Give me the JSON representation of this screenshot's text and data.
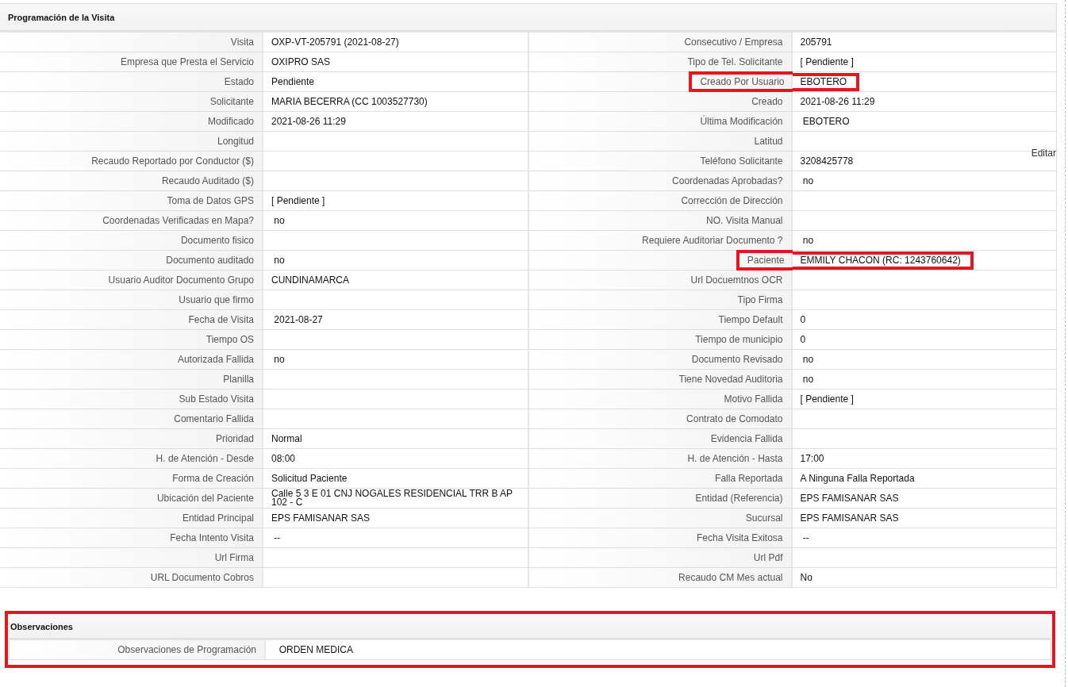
{
  "sections": [
    {
      "title": "Programación de la Visita",
      "highlighted": false,
      "rows": [
        {
          "cells": [
            {
              "label": "Visita",
              "value": "OXP-VT-205791 (2021-08-27)",
              "highlighted": false
            },
            {
              "label": "Consecutivo / Empresa",
              "value": "205791",
              "highlighted": false
            }
          ]
        },
        {
          "cells": [
            {
              "label": "Empresa que Presta el Servicio",
              "value": "OXIPRO SAS",
              "highlighted": false
            },
            {
              "label": "Tipo de Tel. Solicitante",
              "value": "[ Pendiente ]",
              "highlighted": false
            }
          ]
        },
        {
          "cells": [
            {
              "label": "Estado",
              "value": "Pendiente",
              "highlighted": false
            },
            {
              "label": "Creado Por Usuario",
              "value": "EBOTERO",
              "highlighted": true
            }
          ]
        },
        {
          "cells": [
            {
              "label": "Solicitante",
              "value": "MARIA BECERRA (CC 1003527730)",
              "highlighted": false
            },
            {
              "label": "Creado",
              "value": "2021-08-26 11:29",
              "highlighted": false
            }
          ]
        },
        {
          "cells": [
            {
              "label": "Modificado",
              "value": "2021-08-26 11:29",
              "highlighted": false
            },
            {
              "label": "Última Modificación",
              "value": " EBOTERO",
              "highlighted": false
            }
          ]
        },
        {
          "cells": [
            {
              "label": "Longitud",
              "highlighted": false
            },
            {
              "label": "Latitud",
              "highlighted": false
            }
          ]
        },
        {
          "cells": [
            {
              "label": "Recaudo Reportado por Conductor ($)",
              "highlighted": false
            },
            {
              "label": "Teléfono Solicitante",
              "value": "3208425778",
              "highlighted": false,
              "edit_link": "Editar"
            }
          ]
        },
        {
          "cells": [
            {
              "label": "Recaudo Auditado ($)",
              "highlighted": false
            },
            {
              "label": "Coordenadas Aprobadas?",
              "value": " no",
              "highlighted": false
            }
          ]
        },
        {
          "cells": [
            {
              "label": "Toma de Datos GPS",
              "value": "[ Pendiente ]",
              "highlighted": false
            },
            {
              "label": "Corrección de Dirección",
              "highlighted": false
            }
          ]
        },
        {
          "cells": [
            {
              "label": "Coordenadas Verificadas en Mapa?",
              "value": " no",
              "highlighted": false
            },
            {
              "label": "NO. Visita Manual",
              "highlighted": false
            }
          ]
        },
        {
          "cells": [
            {
              "label": "Documento fisico",
              "highlighted": false
            },
            {
              "label": "Requiere Auditoriar Documento ?",
              "value": " no",
              "highlighted": false
            }
          ]
        },
        {
          "cells": [
            {
              "label": "Documento auditado",
              "value": " no",
              "highlighted": false
            },
            {
              "label": "Paciente",
              "value": "EMMILY CHACON (RC: 1243760642)",
              "highlighted": true
            }
          ]
        },
        {
          "cells": [
            {
              "label": "Usuario Auditor Documento Grupo",
              "value": "CUNDINAMARCA",
              "highlighted": false
            },
            {
              "label": "Url Docuemtnos OCR",
              "highlighted": false
            }
          ]
        },
        {
          "cells": [
            {
              "label": "Usuario que firmo",
              "highlighted": false
            },
            {
              "label": "Tipo Firma",
              "highlighted": false
            }
          ]
        },
        {
          "cells": [
            {
              "label": "Fecha de Visita",
              "value": " 2021-08-27",
              "highlighted": false
            },
            {
              "label": "Tiempo Default",
              "value": "0",
              "highlighted": false
            }
          ]
        },
        {
          "cells": [
            {
              "label": "Tiempo OS",
              "highlighted": false
            },
            {
              "label": "Tiempo de municipio",
              "value": "0",
              "highlighted": false
            }
          ]
        },
        {
          "cells": [
            {
              "label": "Autorizada Fallida",
              "value": " no",
              "highlighted": false
            },
            {
              "label": "Documento Revisado",
              "value": " no",
              "highlighted": false
            }
          ]
        },
        {
          "cells": [
            {
              "label": "Planilla",
              "highlighted": false
            },
            {
              "label": "Tiene Novedad Auditoria",
              "value": " no",
              "highlighted": false
            }
          ]
        },
        {
          "cells": [
            {
              "label": "Sub Estado Visita",
              "highlighted": false
            },
            {
              "label": "Motivo Fallida",
              "value": "[ Pendiente ]",
              "highlighted": false
            }
          ]
        },
        {
          "cells": [
            {
              "label": "Comentario Fallida",
              "highlighted": false
            },
            {
              "label": "Contrato de Comodato",
              "highlighted": false
            }
          ]
        },
        {
          "cells": [
            {
              "label": "Prioridad",
              "value": "Normal",
              "highlighted": false
            },
            {
              "label": "Evidencia Fallida",
              "highlighted": false
            }
          ]
        },
        {
          "cells": [
            {
              "label": "H. de Atención - Desde",
              "value": "08:00",
              "highlighted": false
            },
            {
              "label": "H. de Atención - Hasta",
              "value": "17:00",
              "highlighted": false
            }
          ]
        },
        {
          "cells": [
            {
              "label": "Forma de Creación",
              "value": "Solicitud Paciente",
              "highlighted": false
            },
            {
              "label": "Falla Reportada",
              "value": "A Ninguna Falla Reportada",
              "highlighted": false
            }
          ]
        },
        {
          "cells": [
            {
              "label": "Ubicación del Paciente",
              "value": "Calle 5 3 E 01 CNJ NOGALES RESIDENCIAL TRR B AP 102 - C",
              "highlighted": false
            },
            {
              "label": "Entidad (Referencia)",
              "value": "EPS FAMISANAR SAS",
              "highlighted": false
            }
          ]
        },
        {
          "cells": [
            {
              "label": "Entidad Principal",
              "value": "EPS FAMISANAR SAS",
              "highlighted": false
            },
            {
              "label": "Sucursal",
              "value": "EPS FAMISANAR SAS",
              "highlighted": false
            }
          ]
        },
        {
          "cells": [
            {
              "label": "Fecha Intento Visita",
              "value": " --",
              "highlighted": false
            },
            {
              "label": "Fecha Visita Exitosa",
              "value": " --",
              "highlighted": false
            }
          ]
        },
        {
          "cells": [
            {
              "label": "Url Firma",
              "highlighted": false
            },
            {
              "label": "Url Pdf",
              "highlighted": false
            }
          ]
        },
        {
          "cells": [
            {
              "label": "URL Documento Cobros",
              "highlighted": false
            },
            {
              "label": "Recaudo CM Mes actual",
              "value": "No",
              "highlighted": false
            }
          ]
        }
      ]
    },
    {
      "title": "Observaciones",
      "highlighted": true,
      "rows": [
        {
          "cells": [
            {
              "label": "Observaciones de Programación",
              "value": "  ORDEN MEDICA",
              "highlighted": false
            }
          ]
        }
      ]
    }
  ]
}
